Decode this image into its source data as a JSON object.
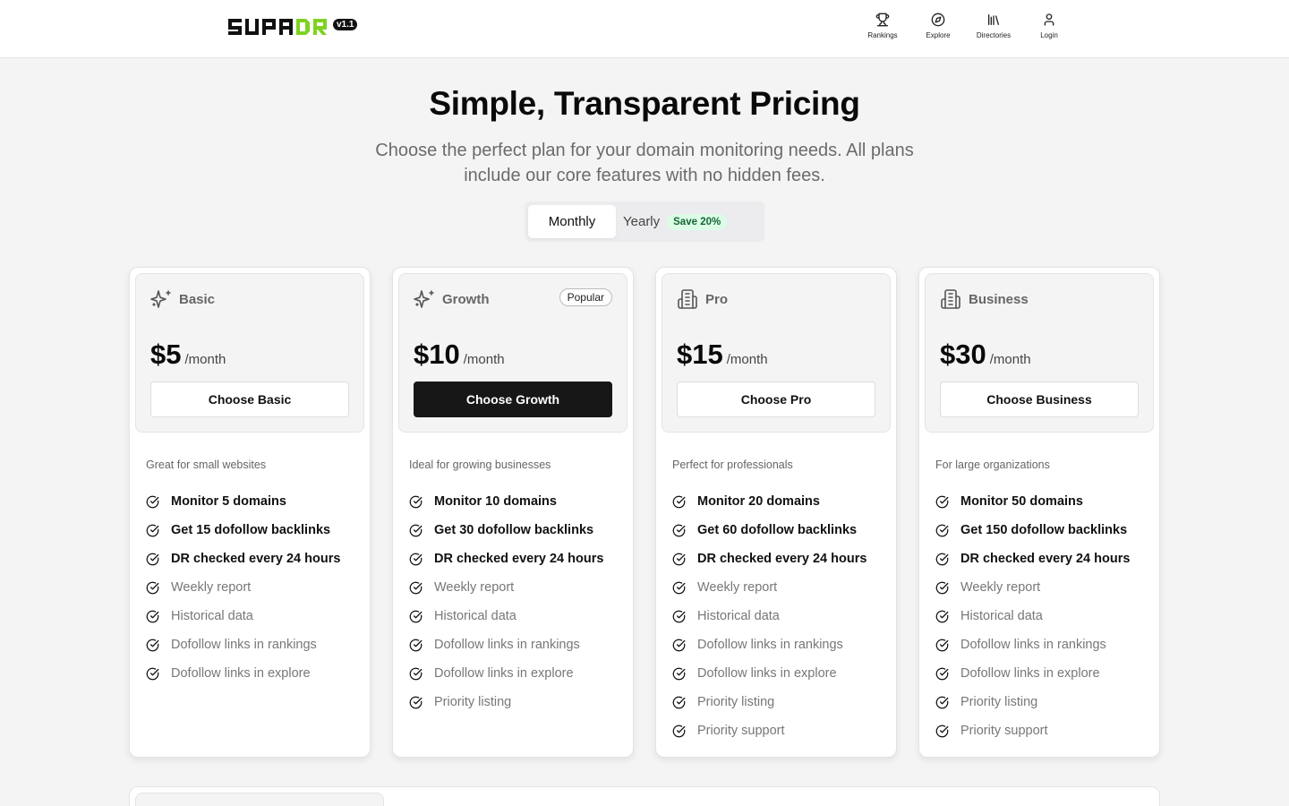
{
  "brand": {
    "name": "SUPADR",
    "version": "v1.1",
    "accent": "#7ed321"
  },
  "nav": [
    {
      "label": "Rankings",
      "icon": "trophy-icon"
    },
    {
      "label": "Explore",
      "icon": "compass-icon"
    },
    {
      "label": "Directories",
      "icon": "library-icon"
    },
    {
      "label": "Login",
      "icon": "user-icon"
    }
  ],
  "hero": {
    "title": "Simple, Transparent Pricing",
    "subtitle": "Choose the perfect plan for your domain monitoring needs. All plans include our core features with no hidden fees."
  },
  "billing": {
    "monthly_label": "Monthly",
    "yearly_label": "Yearly",
    "save_badge": "Save 20%",
    "selected": "Monthly"
  },
  "plans": [
    {
      "name": "Basic",
      "icon": "sparkles-icon",
      "price": "$5",
      "per": "/month",
      "button": "Choose Basic",
      "description": "Great for small websites",
      "features": [
        "Monitor 5 domains",
        "Get 15 dofollow backlinks",
        "DR checked every 24 hours",
        "Weekly report",
        "Historical data",
        "Dofollow links in rankings",
        "Dofollow links in explore"
      ]
    },
    {
      "name": "Growth",
      "icon": "sparkles-icon",
      "badge": "Popular",
      "price": "$10",
      "per": "/month",
      "button": "Choose Growth",
      "description": "Ideal for growing businesses",
      "features": [
        "Monitor 10 domains",
        "Get 30 dofollow backlinks",
        "DR checked every 24 hours",
        "Weekly report",
        "Historical data",
        "Dofollow links in rankings",
        "Dofollow links in explore",
        "Priority listing"
      ]
    },
    {
      "name": "Pro",
      "icon": "building-icon",
      "price": "$15",
      "per": "/month",
      "button": "Choose Pro",
      "description": "Perfect for professionals",
      "features": [
        "Monitor 20 domains",
        "Get 60 dofollow backlinks",
        "DR checked every 24 hours",
        "Weekly report",
        "Historical data",
        "Dofollow links in rankings",
        "Dofollow links in explore",
        "Priority listing",
        "Priority support"
      ]
    },
    {
      "name": "Business",
      "icon": "building-icon",
      "price": "$30",
      "per": "/month",
      "button": "Choose Business",
      "description": "For large organizations",
      "features": [
        "Monitor 50 domains",
        "Get 150 dofollow backlinks",
        "DR checked every 24 hours",
        "Weekly report",
        "Historical data",
        "Dofollow links in rankings",
        "Dofollow links in explore",
        "Priority listing",
        "Priority support"
      ]
    }
  ]
}
